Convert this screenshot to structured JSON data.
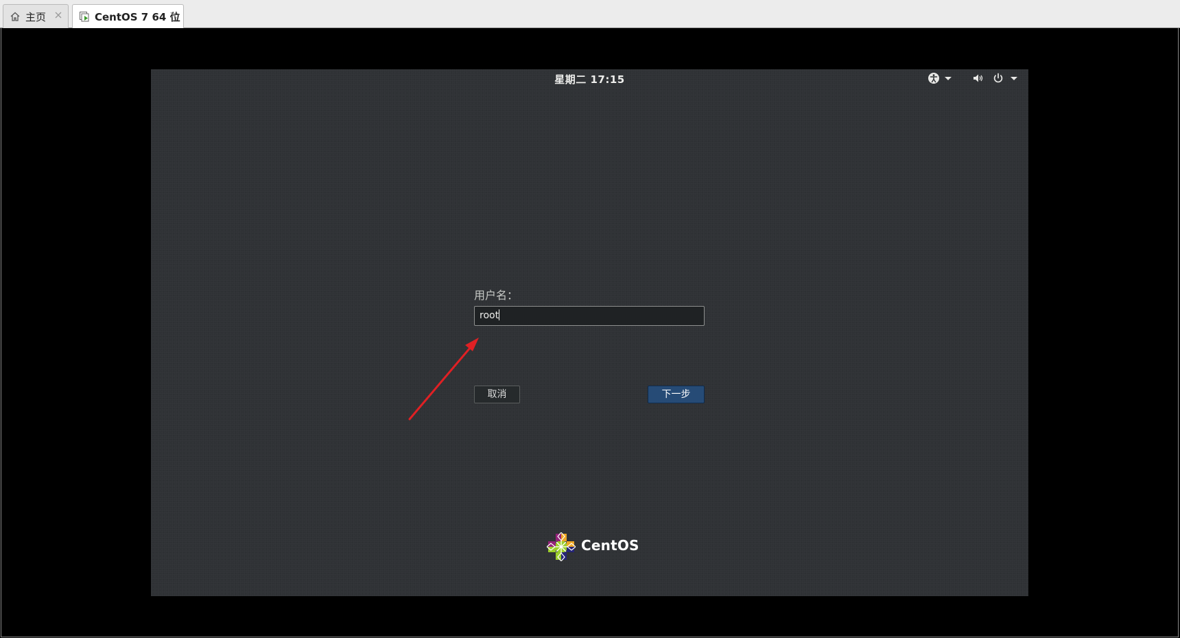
{
  "tabs": [
    {
      "label": "主页",
      "icon": "home-icon",
      "active": false
    },
    {
      "label": "CentOS 7 64 位",
      "icon": "vm-running-icon",
      "active": true
    }
  ],
  "guest": {
    "clock": "星期二 17:15",
    "top_icons": [
      "accessibility-icon",
      "volume-icon",
      "power-icon"
    ],
    "login": {
      "username_label": "用户名：",
      "username_value": "root"
    },
    "buttons": {
      "cancel": "取消",
      "next": "下一步"
    },
    "brand": "CentOS"
  },
  "colors": {
    "screen_bg": "#2f3235",
    "next_button": "#264b76",
    "annotation_arrow": "#e02024"
  }
}
